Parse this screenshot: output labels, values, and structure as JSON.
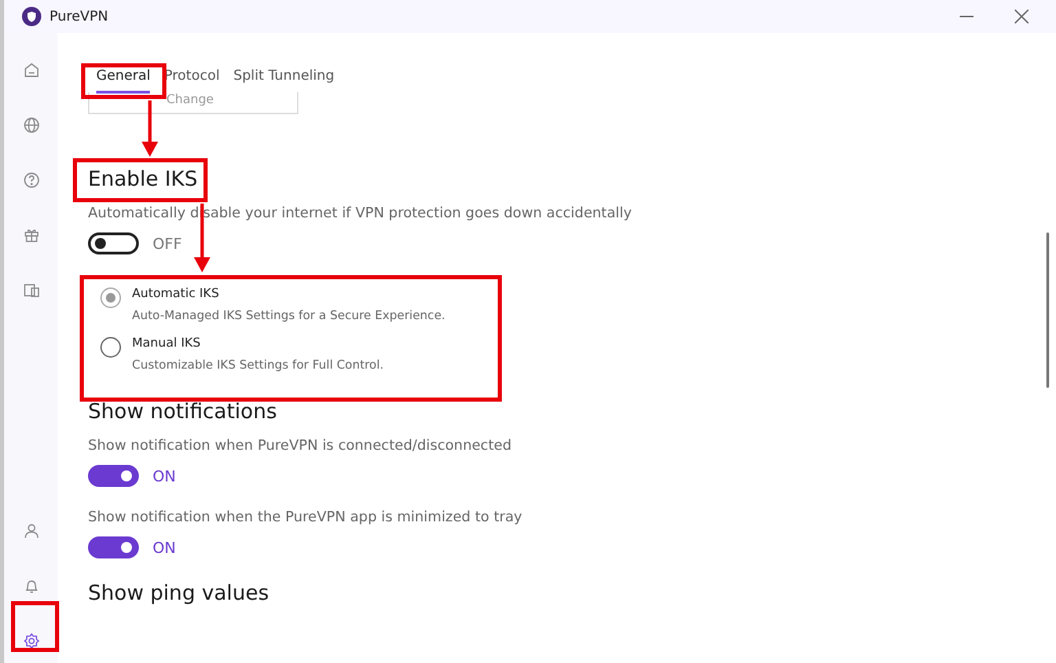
{
  "window": {
    "title": "PureVPN"
  },
  "sidebar": {
    "top_items": [
      {
        "kind": "home",
        "selected": false
      },
      {
        "kind": "globe",
        "selected": false
      },
      {
        "kind": "help",
        "selected": false
      },
      {
        "kind": "gift",
        "selected": false
      },
      {
        "kind": "devices",
        "selected": false
      }
    ],
    "bottom_items": [
      {
        "kind": "user",
        "selected": false
      },
      {
        "kind": "bell",
        "selected": false
      },
      {
        "kind": "settings",
        "selected": true
      }
    ]
  },
  "tabs": [
    {
      "label": "General",
      "selected": true
    },
    {
      "label": "Protocol",
      "selected": false
    },
    {
      "label": "Split Tunneling",
      "selected": false
    }
  ],
  "partial_field": {
    "value": "Change"
  },
  "sections": [
    {
      "heading": "Enable IKS",
      "settings": [
        {
          "kind": "toggle",
          "description": "Automatically disable your internet if VPN protection goes down accidentally",
          "on": false,
          "state_label": "OFF"
        },
        {
          "kind": "radio_group",
          "options": [
            {
              "label": "Automatic IKS",
              "description": "Auto-Managed IKS Settings for a Secure Experience.",
              "selected": true
            },
            {
              "label": "Manual IKS",
              "description": "Customizable IKS Settings for Full Control.",
              "selected": false
            }
          ]
        }
      ]
    },
    {
      "heading": "Show notifications",
      "settings": [
        {
          "kind": "toggle",
          "description": "Show notification when PureVPN is connected/disconnected",
          "on": true,
          "state_label": "ON"
        },
        {
          "kind": "toggle",
          "description": "Show notification when the PureVPN app is minimized to tray",
          "on": true,
          "state_label": "ON"
        }
      ]
    },
    {
      "heading": "Show ping values"
    }
  ]
}
